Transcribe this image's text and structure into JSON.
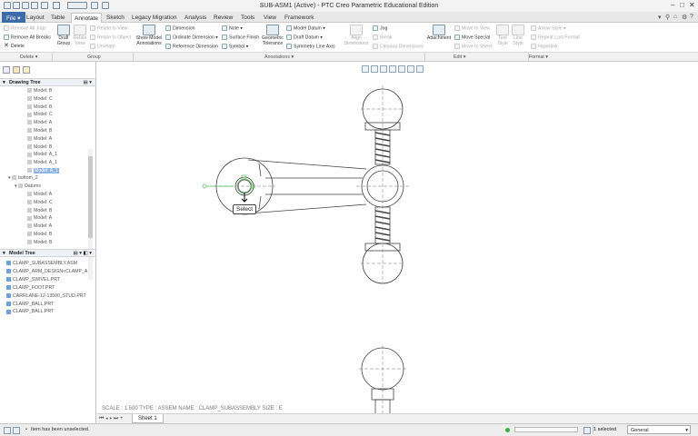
{
  "window": {
    "title": "SUB-ASM1 (Active) - PTC Creo Parametric Educational Edition"
  },
  "tabs": [
    {
      "label": "File"
    },
    {
      "label": "Layout"
    },
    {
      "label": "Table"
    },
    {
      "label": "Annotate"
    },
    {
      "label": "Sketch"
    },
    {
      "label": "Legacy Migration"
    },
    {
      "label": "Analysis"
    },
    {
      "label": "Review"
    },
    {
      "label": "Tools"
    },
    {
      "label": "View"
    },
    {
      "label": "Framework"
    }
  ],
  "ribbon": {
    "delete": {
      "remove_all_jogs": "Remove All Jogs",
      "remove_all_breaks": "Remove All Breaks",
      "delete": "Delete"
    },
    "group": {
      "draft_group": "Draft Group",
      "relate_view": "Relate View",
      "relate_to_view": "Relate to View",
      "relate_to_object": "Relate to Object",
      "unrelate": "Unrelate"
    },
    "annotations": {
      "show_model_annotations": "Show Model Annotations",
      "dimension": "Dimension",
      "ordinate_dimension": "Ordinate Dimension",
      "reference_dimension": "Reference Dimension",
      "note": "Note",
      "surface_finish": "Surface Finish",
      "symbol": "Symbol",
      "geometric_tolerance": "Geometric Tolerance",
      "model_datum": "Model Datum",
      "draft_datum": "Draft Datum",
      "symmetry_line_axis": "Symmetry Line Axis",
      "align_dimensions": "Align Dimensions",
      "jog": "Jog",
      "break": "Break",
      "cleanup_dimensions": "Cleanup Dimensions"
    },
    "edit": {
      "attachment": "Attachment",
      "move_to_view": "Move to View",
      "move_special": "Move Special",
      "move_to_sheet": "Move to Sheet",
      "text_style": "Text Style",
      "line_style": "Line Style"
    },
    "format": {
      "arrow_style": "Arrow Style",
      "repeat_last_format": "Repeat Last Format",
      "hyperlink": "Hyperlink"
    }
  },
  "groups": [
    "Delete",
    "Group",
    "Annotations",
    "Edit",
    "Format"
  ],
  "drawing_tree": {
    "title": "Drawing Tree",
    "items_top": [
      "Model: B",
      "Model: C",
      "Model: B",
      "Model: C",
      "Model: A",
      "Model: B",
      "Model: A",
      "Model: B",
      "Model: A_1",
      "Model: A_1",
      "Model: A_1"
    ],
    "bottom_node": "bottom_2",
    "datums": "Datums",
    "items_bottom": [
      "Model: A",
      "Model: C",
      "Model: B",
      "Model: A",
      "Model: A",
      "Model: B",
      "Model: B"
    ]
  },
  "model_tree": {
    "title": "Model Tree",
    "items": [
      "CLAMP_SUBASSEMBLY.ASM",
      "CLAMP_ARM_DESIGN<CLAMP_A",
      "CLAMP_SWIVEL.PRT",
      "CLAMP_FOOT.PRT",
      "CARRLANE-12-13500_STUD.PRT",
      "CLAMP_BALL.PRT",
      "CLAMP_BALL.PRT"
    ]
  },
  "canvas": {
    "tooltip": "Select",
    "sheet_info": "SCALE : 1.500    TYPE : ASSEM    NAME : CLAMP_SUBASSEMBLY    SIZE : E"
  },
  "sheet": {
    "label": "Sheet 1"
  },
  "status": {
    "message": "Item has been unselected.",
    "selected": "1 selected",
    "filter": "General"
  }
}
